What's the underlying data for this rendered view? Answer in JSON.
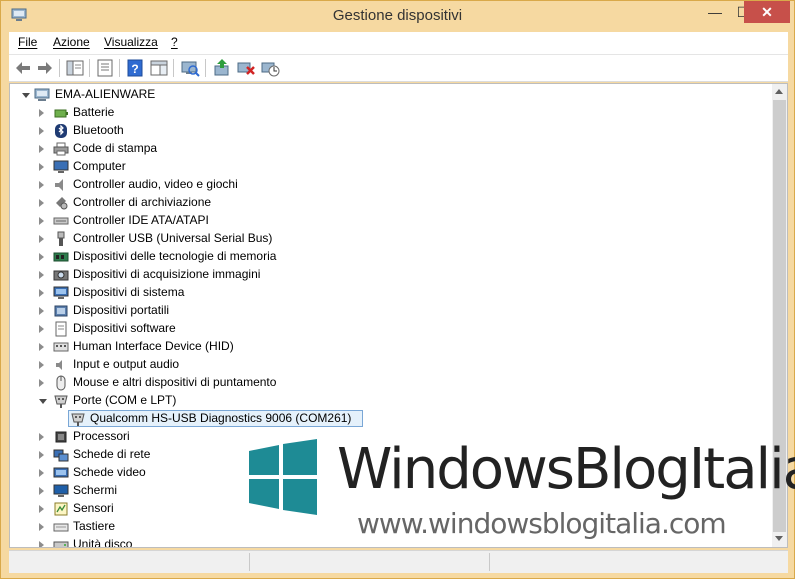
{
  "window": {
    "title": "Gestione dispositivi",
    "minimize": "—",
    "maximize": "☐",
    "close": "✕"
  },
  "menu": {
    "items": [
      "File",
      "Azione",
      "Visualizza",
      "?"
    ]
  },
  "toolbar": {
    "icons": [
      "back-arrow-icon",
      "forward-arrow-icon",
      "show-hide-console-tree-icon",
      "properties-icon",
      "help-icon",
      "action-pane-icon",
      "scan-hardware-icon",
      "update-driver-icon",
      "uninstall-device-icon",
      "disable-device-icon"
    ]
  },
  "tree": {
    "root": "EMA-ALIENWARE",
    "categories": [
      {
        "label": "Batterie",
        "icon": "battery-icon"
      },
      {
        "label": "Bluetooth",
        "icon": "bluetooth-icon"
      },
      {
        "label": "Code di stampa",
        "icon": "printer-icon"
      },
      {
        "label": "Computer",
        "icon": "computer-icon"
      },
      {
        "label": "Controller audio, video e giochi",
        "icon": "speaker-icon"
      },
      {
        "label": "Controller di archiviazione",
        "icon": "storage-controller-icon"
      },
      {
        "label": "Controller IDE ATA/ATAPI",
        "icon": "ide-controller-icon"
      },
      {
        "label": "Controller USB (Universal Serial Bus)",
        "icon": "usb-icon"
      },
      {
        "label": "Dispositivi delle tecnologie di memoria",
        "icon": "memory-icon"
      },
      {
        "label": "Dispositivi di acquisizione immagini",
        "icon": "camera-icon"
      },
      {
        "label": "Dispositivi di sistema",
        "icon": "system-device-icon"
      },
      {
        "label": "Dispositivi portatili",
        "icon": "portable-device-icon"
      },
      {
        "label": "Dispositivi software",
        "icon": "software-device-icon"
      },
      {
        "label": "Human Interface Device (HID)",
        "icon": "hid-icon"
      },
      {
        "label": "Input e output audio",
        "icon": "audio-io-icon"
      },
      {
        "label": "Mouse e altri dispositivi di puntamento",
        "icon": "mouse-icon"
      },
      {
        "label": "Porte (COM e LPT)",
        "icon": "port-icon",
        "expanded": true
      },
      {
        "label": "Qualcomm HS-USB Diagnostics 9006 (COM261)",
        "icon": "port-icon",
        "child": true,
        "selected": true
      },
      {
        "label": "Processori",
        "icon": "processor-icon"
      },
      {
        "label": "Schede di rete",
        "icon": "network-adapter-icon"
      },
      {
        "label": "Schede video",
        "icon": "display-adapter-icon"
      },
      {
        "label": "Schermi",
        "icon": "monitor-icon"
      },
      {
        "label": "Sensori",
        "icon": "sensor-icon"
      },
      {
        "label": "Tastiere",
        "icon": "keyboard-icon"
      },
      {
        "label": "Unità disco",
        "icon": "disk-drive-icon"
      }
    ]
  },
  "watermark": {
    "brand": "WindowsBlogItalia",
    "url": "www.windowsblogitalia.com",
    "color": "#1e8b95"
  }
}
